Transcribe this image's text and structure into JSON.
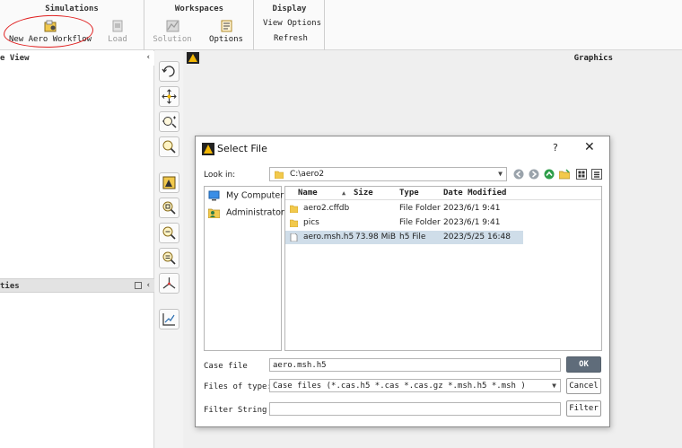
{
  "ribbon": {
    "simulations": {
      "title": "Simulations",
      "new_aero_workflow": "New Aero Workflow",
      "load": "Load"
    },
    "workspaces": {
      "title": "Workspaces",
      "solution": "Solution",
      "options": "Options"
    },
    "display": {
      "title": "Display",
      "view_options": "View Options",
      "refresh": "Refresh"
    }
  },
  "left": {
    "tree_view_title": "e View",
    "properties_title": "ties"
  },
  "graphics": {
    "title": "Graphics"
  },
  "dialog": {
    "title": "Select File",
    "help": "?",
    "close": "✕",
    "look_in_label": "Look in:",
    "look_in_value": "C:\\aero2",
    "sidebar": [
      "My Computer",
      "Administrator"
    ],
    "columns": [
      "Name",
      "Size",
      "Type",
      "Date Modified"
    ],
    "files": [
      {
        "name": "aero2.cffdb",
        "size": "",
        "type": "File Folder",
        "date": "2023/6/1 9:41",
        "icon": "folder-icon",
        "selected": false
      },
      {
        "name": "pics",
        "size": "",
        "type": "File Folder",
        "date": "2023/6/1 9:41",
        "icon": "folder-icon",
        "selected": false
      },
      {
        "name": "aero.msh.h5",
        "size": "73.98 MiB",
        "type": "h5 File",
        "date": "2023/5/25 16:48",
        "icon": "file-icon",
        "selected": true
      }
    ],
    "case_file_label": "Case file",
    "case_file_value": "aero.msh.h5",
    "files_of_type_label": "Files of type:",
    "files_of_type_value": "Case files (*.cas.h5 *.cas *.cas.gz *.msh.h5 *.msh )",
    "filter_string_label": "Filter String",
    "filter_string_value": "",
    "ok_label": "OK",
    "cancel_label": "Cancel",
    "filter_label": "Filter"
  },
  "colors": {
    "annotation_circle": "#e02020",
    "selected_row": "#cfdde9",
    "ok_button": "#5f6c7a"
  }
}
